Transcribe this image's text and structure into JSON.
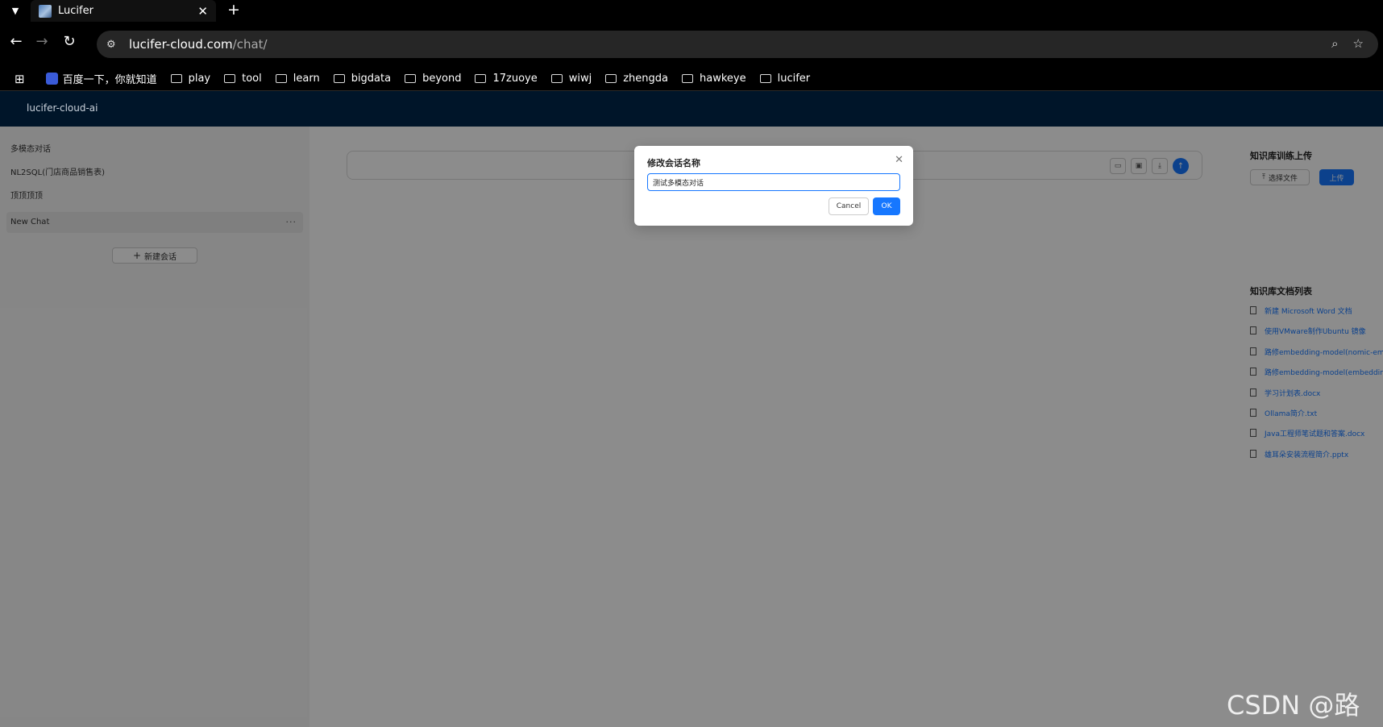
{
  "browser": {
    "tab_title": "Lucifer",
    "tab_close": "✕",
    "new_tab": "+",
    "url_host": "lucifer-cloud.com",
    "url_path": "/chat/",
    "bookmarks": [
      {
        "label": "百度一下，你就知道",
        "icon": "baidu-icon"
      },
      {
        "label": "play",
        "icon": "folder-icon"
      },
      {
        "label": "tool",
        "icon": "folder-icon"
      },
      {
        "label": "learn",
        "icon": "folder-icon"
      },
      {
        "label": "bigdata",
        "icon": "folder-icon"
      },
      {
        "label": "beyond",
        "icon": "folder-icon"
      },
      {
        "label": "17zuoye",
        "icon": "folder-icon"
      },
      {
        "label": "wiwj",
        "icon": "folder-icon"
      },
      {
        "label": "zhengda",
        "icon": "folder-icon"
      },
      {
        "label": "hawkeye",
        "icon": "folder-icon"
      },
      {
        "label": "lucifer",
        "icon": "folder-icon"
      }
    ]
  },
  "app": {
    "brand": "lucifer-cloud-ai"
  },
  "sidebar": {
    "conversations": [
      {
        "label": "多模态对话"
      },
      {
        "label": "NL2SQL(门店商品销售表)"
      },
      {
        "label": "顶顶顶顶"
      },
      {
        "label": "New Chat",
        "more": "···"
      }
    ],
    "new_chat_label": "新建会话"
  },
  "knowledge": {
    "upload_title": "知识库训练上传",
    "select_file_label": "选择文件",
    "upload_label": "上传",
    "list_title": "知识库文档列表",
    "documents": [
      "新建 Microsoft Word 文档",
      "使用VMware制作Ubuntu 镜像",
      "路修embedding-model(nomic-embed",
      "路修embedding-model(embedding",
      "学习计划表.docx",
      "Ollama简介.txt",
      "Java工程师笔试题和答案.docx",
      "雄耳朵安装流程简介.pptx"
    ]
  },
  "modal": {
    "title": "修改会话名称",
    "input_value": "测试多模态对话",
    "cancel_label": "Cancel",
    "ok_label": "OK"
  },
  "watermark": "CSDN @路修",
  "colors": {
    "primary": "#1677ff",
    "header_bg": "#001529"
  }
}
